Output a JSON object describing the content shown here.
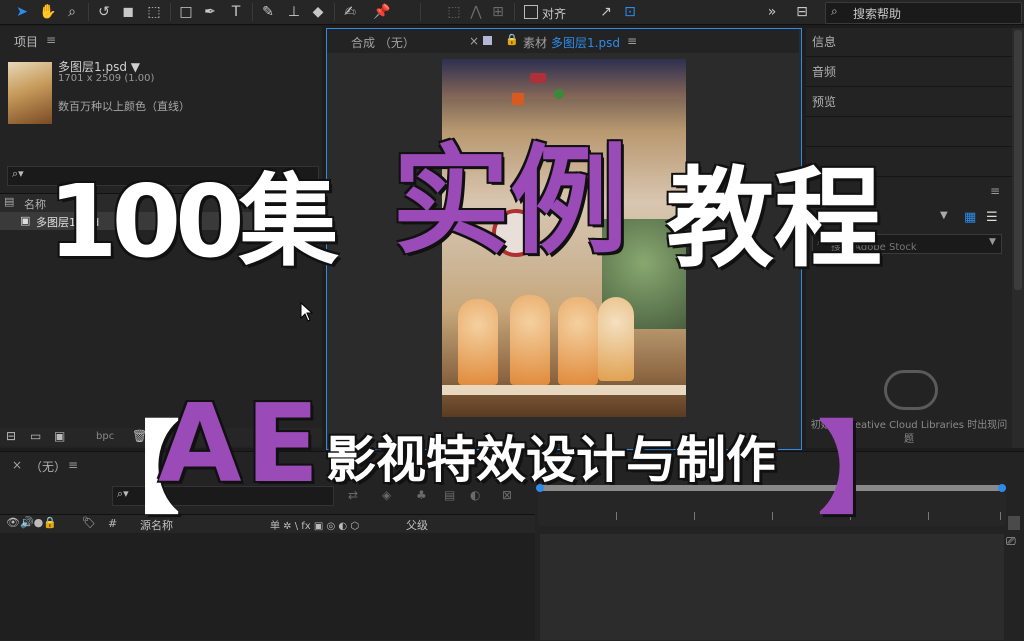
{
  "toolbar": {
    "align_label": "对齐",
    "search_placeholder": "搜索帮助"
  },
  "project": {
    "panel_title": "项目",
    "file_name": "多图层1.psd ▼",
    "file_dims": "1701 x 2509 (1.00)",
    "file_color": "数百万种以上颜色（直线）",
    "col_name": "名称",
    "row_name": "多图层1.psd",
    "bpc_label": "bpc"
  },
  "viewer": {
    "comp_tab": "合成 （无）",
    "footage_tab_prefix": "素材",
    "footage_tab_name": "多图层1.psd"
  },
  "right_panels": {
    "info": "信息",
    "audio": "音频",
    "preview": "预览",
    "stock_search": "搜索 Adobe Stock",
    "cc_message_1": "初始化 Creative Cloud Libraries 时出现问",
    "cc_message_2": "题"
  },
  "timeline": {
    "tab_title": "（无）",
    "col_hash": "#",
    "col_source": "源名称",
    "col_switches": "单 ✲ \\ fx ▣ ◎ ◐ ⬡",
    "col_parent": "父级"
  },
  "overlay": {
    "title_part1": "100集",
    "title_part2": "实例",
    "title_part3": "教程",
    "bracket_left": "【",
    "ae": "AE",
    "subtitle": "影视特效设计与制作",
    "bracket_right": "】"
  },
  "colors": {
    "accent_purple": "#9b4bb8",
    "panel_bg": "#232323",
    "active_border": "#2d8ceb"
  }
}
